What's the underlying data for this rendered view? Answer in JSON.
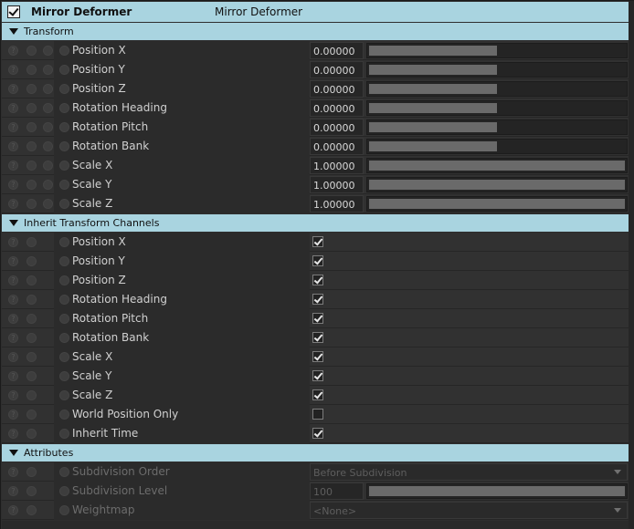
{
  "title": {
    "checked": true,
    "label": "Mirror Deformer",
    "secondary": "Mirror Deformer"
  },
  "sections": {
    "transform": {
      "label": "Transform"
    },
    "inherit": {
      "label": "Inherit Transform Channels"
    },
    "attributes": {
      "label": "Attributes"
    }
  },
  "transform_rows": [
    {
      "label": "Position X",
      "value": "0.00000",
      "slider_fraction": 0.5
    },
    {
      "label": "Position Y",
      "value": "0.00000",
      "slider_fraction": 0.5
    },
    {
      "label": "Position Z",
      "value": "0.00000",
      "slider_fraction": 0.5
    },
    {
      "label": "Rotation Heading",
      "value": "0.00000",
      "slider_fraction": 0.5
    },
    {
      "label": "Rotation Pitch",
      "value": "0.00000",
      "slider_fraction": 0.5
    },
    {
      "label": "Rotation Bank",
      "value": "0.00000",
      "slider_fraction": 0.5
    },
    {
      "label": "Scale X",
      "value": "1.00000",
      "slider_fraction": 1.0
    },
    {
      "label": "Scale Y",
      "value": "1.00000",
      "slider_fraction": 1.0
    },
    {
      "label": "Scale Z",
      "value": "1.00000",
      "slider_fraction": 1.0
    }
  ],
  "inherit_rows": [
    {
      "label": "Position X",
      "checked": true
    },
    {
      "label": "Position Y",
      "checked": true
    },
    {
      "label": "Position Z",
      "checked": true
    },
    {
      "label": "Rotation Heading",
      "checked": true
    },
    {
      "label": "Rotation Pitch",
      "checked": true
    },
    {
      "label": "Rotation Bank",
      "checked": true
    },
    {
      "label": "Scale X",
      "checked": true
    },
    {
      "label": "Scale Y",
      "checked": true
    },
    {
      "label": "Scale Z",
      "checked": true
    },
    {
      "label": "World Position Only",
      "checked": false
    },
    {
      "label": "Inherit Time",
      "checked": true
    }
  ],
  "attribute_rows": {
    "subdivision_order": {
      "label": "Subdivision Order",
      "value": "Before Subdivision"
    },
    "subdivision_level": {
      "label": "Subdivision Level",
      "value": "100",
      "slider_fraction": 1.0
    },
    "weightmap": {
      "label": "Weightmap",
      "value": "<None>"
    }
  },
  "colors": {
    "section_header": "#a9d4e0",
    "panel_bg": "#2e2e2e",
    "row_bg": "#313131"
  }
}
